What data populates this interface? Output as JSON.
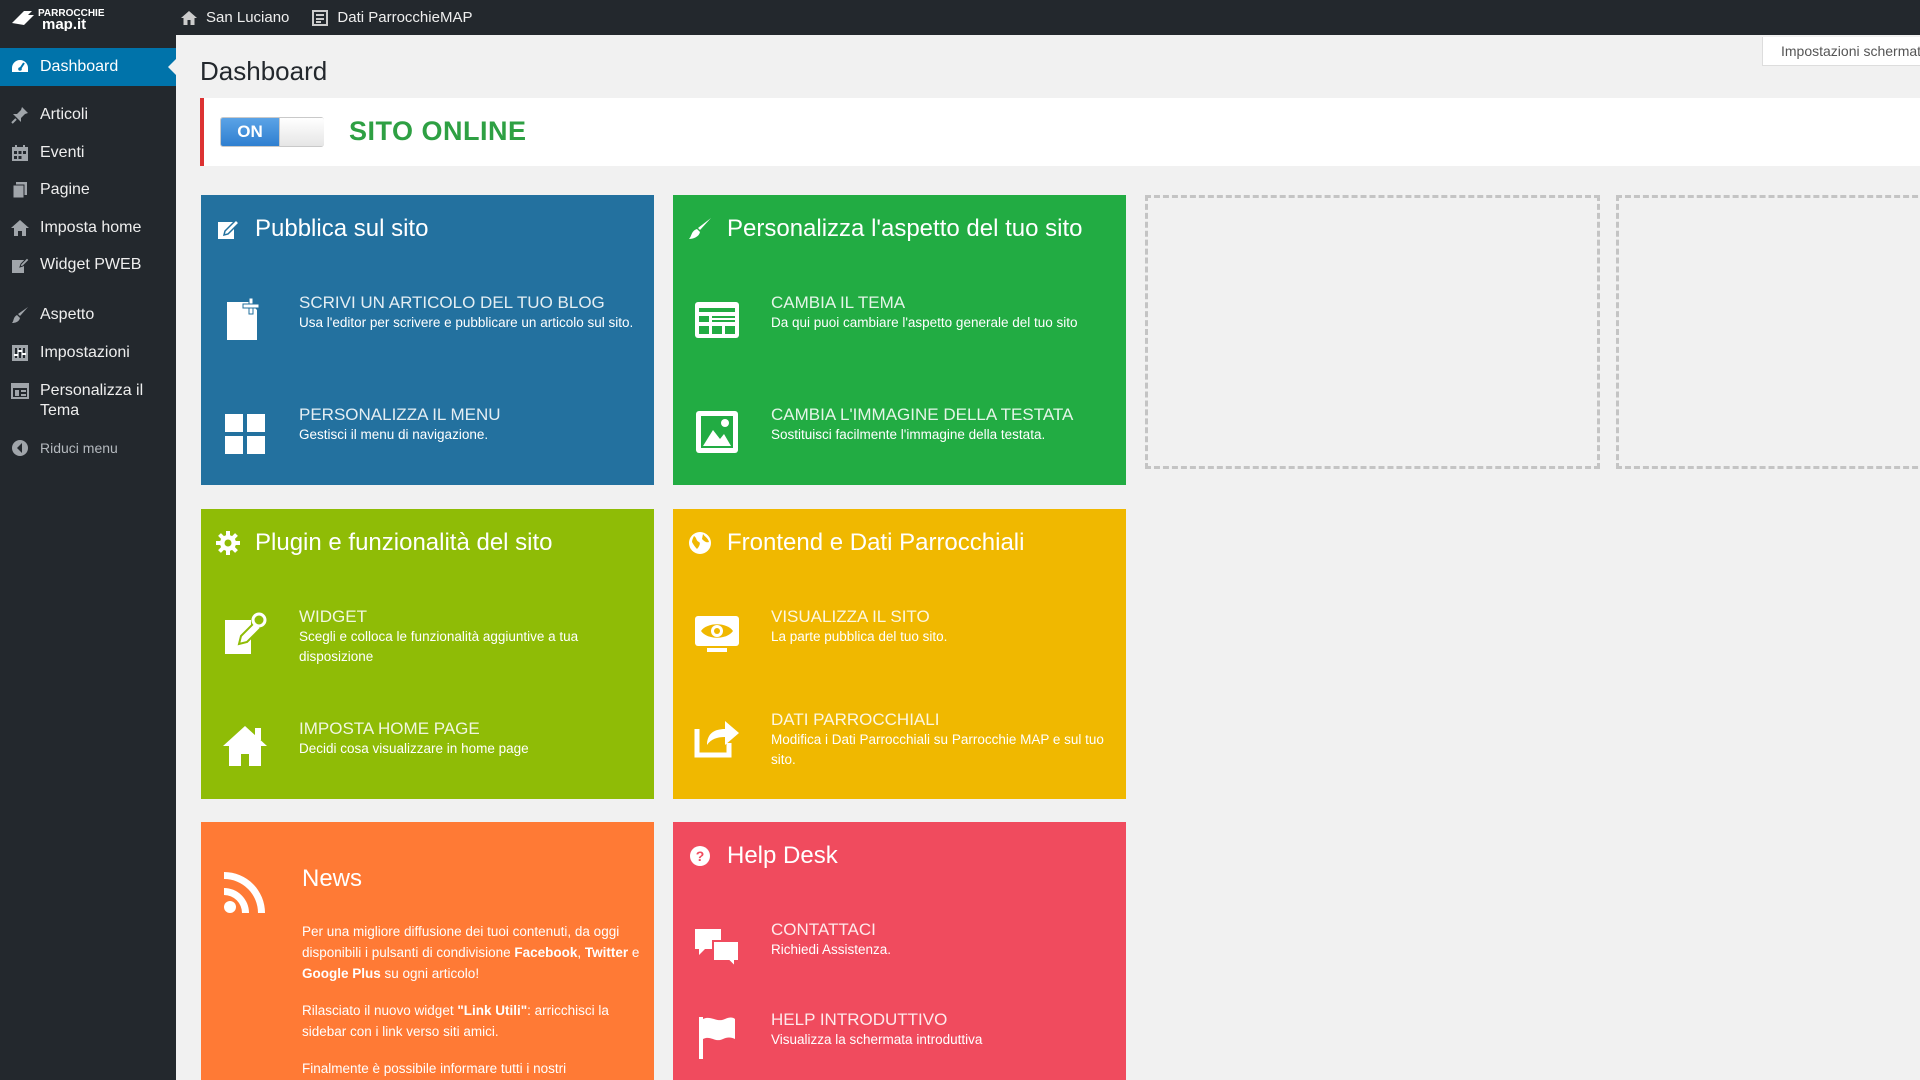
{
  "topbar": {
    "logo_text": "PARROCCHIE map.it",
    "site_name": "San Luciano",
    "data_link": "Dati ParrocchieMAP"
  },
  "sidebar": {
    "items": [
      {
        "label": "Dashboard",
        "icon": "dashboard-icon",
        "active": true
      },
      {
        "label": "Articoli",
        "icon": "pin-icon"
      },
      {
        "label": "Eventi",
        "icon": "calendar-icon"
      },
      {
        "label": "Pagine",
        "icon": "pages-icon"
      },
      {
        "label": "Imposta home",
        "icon": "home-icon"
      },
      {
        "label": "Widget PWEB",
        "icon": "widget-icon"
      },
      {
        "label": "Aspetto",
        "icon": "brush-icon"
      },
      {
        "label": "Impostazioni",
        "icon": "settings-icon"
      },
      {
        "label": "Personalizza il Tema",
        "icon": "theme-icon"
      }
    ],
    "collapse_label": "Riduci menu"
  },
  "screen_options": "Impostazioni schermata",
  "page_title": "Dashboard",
  "status": {
    "toggle_label": "ON",
    "text": "SITO ONLINE",
    "text_color": "#2ea043",
    "border_color": "#dc3232"
  },
  "tiles": {
    "pubblica": {
      "color": "#23719f",
      "title": "Pubblica sul sito",
      "actions": [
        {
          "title": "SCRIVI UN ARTICOLO DEL TUO BLOG",
          "desc": "Usa l'editor per scrivere e pubblicare un articolo sul sito."
        },
        {
          "title": "PERSONALIZZA IL MENU",
          "desc": "Gestisci il menu di navigazione."
        }
      ]
    },
    "aspetto": {
      "color": "#22ac43",
      "title": "Personalizza l'aspetto del tuo sito",
      "actions": [
        {
          "title": "CAMBIA IL TEMA",
          "desc": "Da qui puoi cambiare l'aspetto generale del tuo sito"
        },
        {
          "title": "CAMBIA L'IMMAGINE DELLA TESTATA",
          "desc": "Sostituisci facilmente l'immagine della testata."
        }
      ]
    },
    "plugin": {
      "color": "#8fbc06",
      "title": "Plugin e funzionalità del sito",
      "actions": [
        {
          "title": "WIDGET",
          "desc": "Scegli e colloca le funzionalità aggiuntive a tua disposizione"
        },
        {
          "title": "IMPOSTA HOME PAGE",
          "desc": "Decidi cosa visualizzare in home page"
        }
      ]
    },
    "frontend": {
      "color": "#f0b800",
      "title": "Frontend e Dati Parrocchiali",
      "actions": [
        {
          "title": "VISUALIZZA IL SITO",
          "desc": "La parte pubblica del tuo sito."
        },
        {
          "title": "DATI PARROCCHIALI",
          "desc": "Modifica i Dati Parrocchiali su Parrocchie MAP e sul tuo sito."
        }
      ]
    },
    "news": {
      "color": "#ff7a35",
      "title": "News",
      "p1_pre": "Per una migliore diffusione dei tuoi contenuti, da oggi disponibili i pulsanti di condivisione ",
      "p1_facebook": "Facebook",
      "p1_comma": ", ",
      "p1_twitter": "Twitter",
      "p1_and": " e ",
      "p1_gplus": "Google Plus",
      "p1_post": " su ogni articolo!",
      "p2_pre": "Rilasciato il nuovo widget ",
      "p2_widget": "\"Link Utili\"",
      "p2_post": ": arricchisci la sidebar con i link verso siti amici.",
      "p3": "Finalmente è possibile informare tutti i nostri"
    },
    "help": {
      "color": "#f04b5e",
      "title": "Help Desk",
      "actions": [
        {
          "title": "CONTATTACI",
          "desc": "Richiedi Assistenza."
        },
        {
          "title": "HELP INTRODUTTIVO",
          "desc": "Visualizza la schermata introduttiva"
        }
      ]
    }
  }
}
